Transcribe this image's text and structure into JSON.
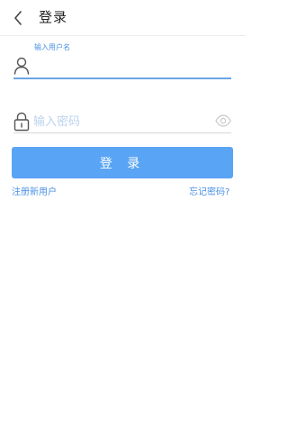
{
  "header": {
    "title": "登录"
  },
  "username": {
    "label": "输入用户名",
    "value": ""
  },
  "password": {
    "placeholder": "输入密码",
    "value": ""
  },
  "actions": {
    "login_label": "登 录"
  },
  "links": {
    "register": "注册新用户",
    "forgot": "忘记密码?"
  },
  "colors": {
    "accent": "#5aa4f5",
    "link": "#4a90e2",
    "placeholder": "#bcd3ee"
  }
}
